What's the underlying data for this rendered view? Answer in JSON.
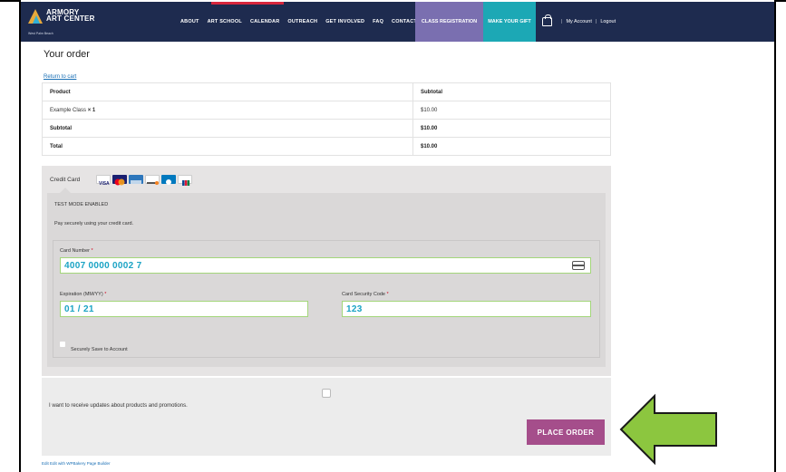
{
  "nav": {
    "logo_line1": "ARMORY",
    "logo_line2": "ART CENTER",
    "logo_sub": "West Palm Beach",
    "links": [
      "ABOUT",
      "ART SCHOOL",
      "CALENDAR",
      "OUTREACH",
      "GET INVOLVED",
      "FAQ",
      "CONTACT"
    ],
    "class_registration": "CLASS REGISTRATION",
    "make_your_gift": "MAKE YOUR GIFT",
    "my_account": "My Account",
    "logout": "Logout",
    "separator": "|"
  },
  "page": {
    "title": "Your order",
    "return_link": "Return to cart"
  },
  "order_table": {
    "headers": [
      "Product",
      "Subtotal"
    ],
    "rows": [
      {
        "product": "Example Class",
        "qty": "× 1",
        "subtotal": "$10.00"
      },
      {
        "product": "Subtotal",
        "subtotal": "$10.00"
      },
      {
        "product": "Total",
        "subtotal": "$10.00"
      }
    ]
  },
  "payment": {
    "method_label": "Credit Card",
    "card_brands": [
      "visa",
      "mastercard",
      "amex",
      "discover",
      "diners",
      "jcb"
    ],
    "test_mode": "TEST MODE ENABLED",
    "description": "Pay securely using your credit card.",
    "card_number_label": "Card Number",
    "card_number_value": "4007 0000 0002 7",
    "expiration_label": "Expiration (MM/YY)",
    "expiration_value": "01 / 21",
    "security_code_label": "Card Security Code",
    "security_code_value": "123",
    "save_label": "Securely Save to Account",
    "required_marker": "*"
  },
  "bottom": {
    "promo_text": "I want to receive updates about products and promotions.",
    "place_order": "PLACE ORDER",
    "edit_link": "Edit Edit with WPBakery Page Builder"
  },
  "colors": {
    "nav_bg": "#1e2b4f",
    "class_registration_bg": "#7a6fb0",
    "gift_bg": "#1ca8b5",
    "place_order_bg": "#a54e8b",
    "input_text": "#1aa3c4",
    "arrow_fill": "#8cc63f"
  }
}
